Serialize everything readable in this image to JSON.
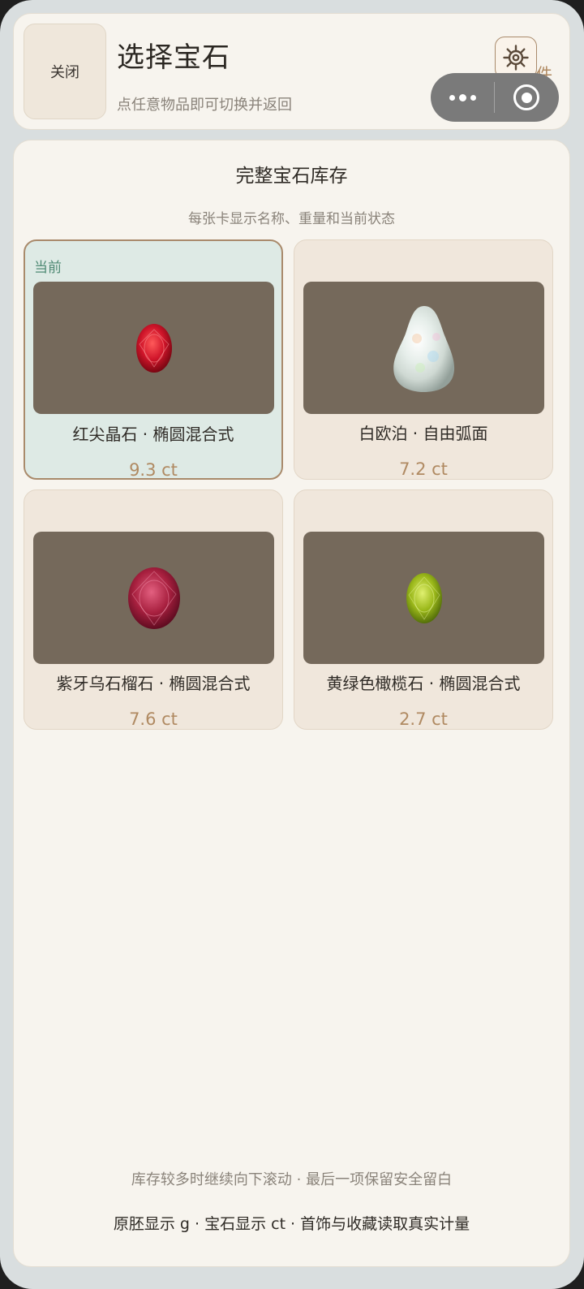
{
  "header": {
    "close_label": "关闭",
    "title": "选择宝石",
    "subtitle": "点任意物品即可切换并返回",
    "settings_tag": "件"
  },
  "panel": {
    "title": "完整宝石库存",
    "subtitle": "每张卡显示名称、重量和当前状态",
    "current_badge": "当前",
    "gems": [
      {
        "name": "红尖晶石 · 椭圆混合式",
        "weight": "9.3 ct",
        "current": true,
        "color": "#d0152a",
        "shape": "oval"
      },
      {
        "name": "白欧泊 · 自由弧面",
        "weight": "7.2 ct",
        "current": false,
        "color": "#dfe6e4",
        "shape": "freeform"
      },
      {
        "name": "紫牙乌石榴石 · 椭圆混合式",
        "weight": "7.6 ct",
        "current": false,
        "color": "#a8203f",
        "shape": "oval"
      },
      {
        "name": "黄绿色橄榄石 · 椭圆混合式",
        "weight": "2.7 ct",
        "current": false,
        "color": "#9bb81a",
        "shape": "oval"
      }
    ],
    "footer_note": "库存较多时继续向下滚动 · 最后一项保留安全留白",
    "footer_units": "原胚显示 g · 宝石显示 ct · 首饰与收藏读取真实计量"
  },
  "colors": {
    "accent": "#b08a62",
    "current_badge": "#4f8a74",
    "stage": "#75695b"
  }
}
